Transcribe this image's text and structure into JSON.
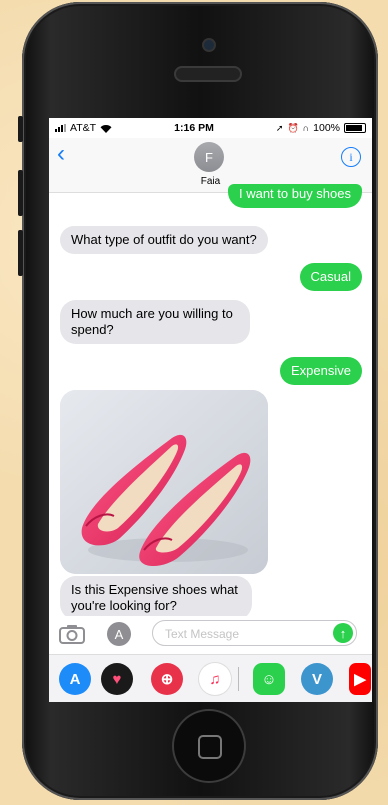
{
  "status": {
    "carrier": "AT&T",
    "time": "1:16 PM",
    "battery": "100%"
  },
  "header": {
    "avatar_initial": "F",
    "contact_name": "Faia",
    "info_glyph": "i",
    "back_glyph": "‹"
  },
  "messages": [
    {
      "side": "out",
      "text": "I want to buy shoes"
    },
    {
      "side": "in",
      "text": "What type of outfit do you want?"
    },
    {
      "side": "out",
      "text": "Casual"
    },
    {
      "side": "in",
      "text": "How much are you willing to spend?"
    },
    {
      "side": "out",
      "text": "Expensive"
    },
    {
      "side": "in",
      "type": "image",
      "image_subject": "pink ballet flat shoes"
    },
    {
      "side": "in",
      "text": "Is this Expensive shoes what you're looking for?"
    }
  ],
  "composer": {
    "placeholder": "Text Message",
    "send_glyph": "↑",
    "apps_glyph": "A"
  },
  "app_drawer": [
    {
      "name": "app-store-icon",
      "color": "#1d8cf8"
    },
    {
      "name": "heart-digital-touch-icon",
      "color": "#1a1a1a"
    },
    {
      "name": "images-search-icon",
      "color": "#e8324a"
    },
    {
      "name": "music-icon",
      "color": "#ffffff"
    },
    {
      "name": "bitmoji-icon",
      "color": "#2bd14d"
    },
    {
      "name": "venmo-icon",
      "color": "#3d95ce"
    },
    {
      "name": "youtube-icon",
      "color": "#ff0000"
    }
  ],
  "colors": {
    "accent": "#157efb",
    "outgoing": "#2bd14d",
    "incoming": "#e5e5ea"
  }
}
